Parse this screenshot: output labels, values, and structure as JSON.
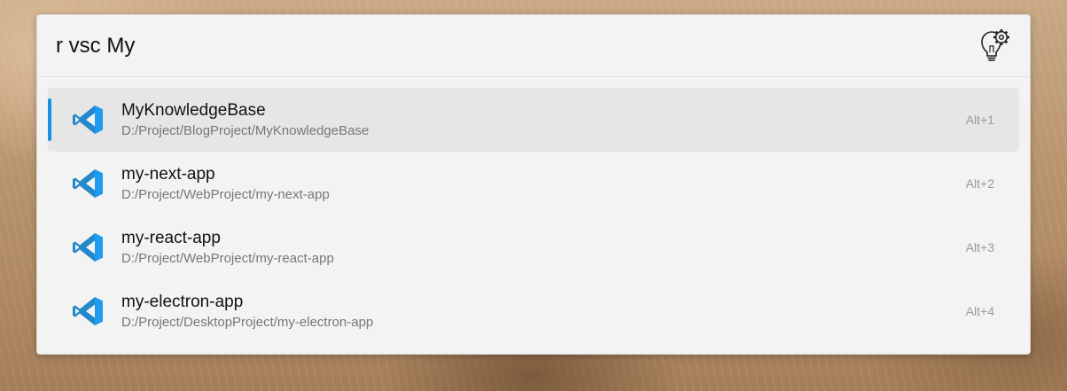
{
  "search": {
    "value": "r vsc My"
  },
  "header": {
    "settings_icon": "lightbulb-gear-icon"
  },
  "colors": {
    "accent": "#1a8fe3",
    "vscode_blue": "#2489ca",
    "vscode_light": "#1f9cf0",
    "selected_bg": "#e6e6e6",
    "panel_bg": "#f3f3f3"
  },
  "results": [
    {
      "title": "MyKnowledgeBase",
      "path": "D:/Project/BlogProject/MyKnowledgeBase",
      "shortcut": "Alt+1",
      "icon": "vscode-icon",
      "selected": true
    },
    {
      "title": "my-next-app",
      "path": "D:/Project/WebProject/my-next-app",
      "shortcut": "Alt+2",
      "icon": "vscode-icon",
      "selected": false
    },
    {
      "title": "my-react-app",
      "path": "D:/Project/WebProject/my-react-app",
      "shortcut": "Alt+3",
      "icon": "vscode-icon",
      "selected": false
    },
    {
      "title": "my-electron-app",
      "path": "D:/Project/DesktopProject/my-electron-app",
      "shortcut": "Alt+4",
      "icon": "vscode-icon",
      "selected": false
    }
  ]
}
